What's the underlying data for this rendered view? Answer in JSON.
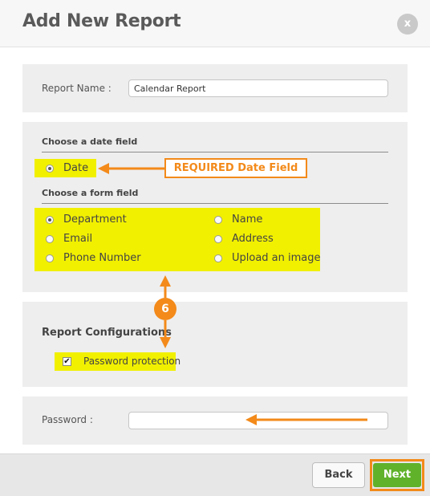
{
  "dialog": {
    "title": "Add New Report",
    "close_label": "x"
  },
  "report_name": {
    "label": "Report Name :",
    "value": "Calendar Report"
  },
  "date_section": {
    "heading": "Choose a date field",
    "options": [
      {
        "label": "Date",
        "selected": true
      }
    ]
  },
  "form_section": {
    "heading": "Choose a form field",
    "options": [
      {
        "label": "Department",
        "selected": true
      },
      {
        "label": "Email",
        "selected": false
      },
      {
        "label": "Phone Number",
        "selected": false
      },
      {
        "label": "Name",
        "selected": false
      },
      {
        "label": "Address",
        "selected": false
      },
      {
        "label": "Upload an image",
        "selected": false
      }
    ]
  },
  "config_section": {
    "heading": "Report Configurations",
    "password_protection": {
      "label": "Password protection",
      "checked": true
    }
  },
  "password": {
    "label": "Password :",
    "value": ""
  },
  "annotations": {
    "required_callout": "REQUIRED Date Field",
    "step_number": "6"
  },
  "footer": {
    "back_label": "Back",
    "next_label": "Next"
  },
  "colors": {
    "highlight": "#f1f000",
    "annotation": "#f38a1a",
    "next_button": "#60b22a"
  }
}
